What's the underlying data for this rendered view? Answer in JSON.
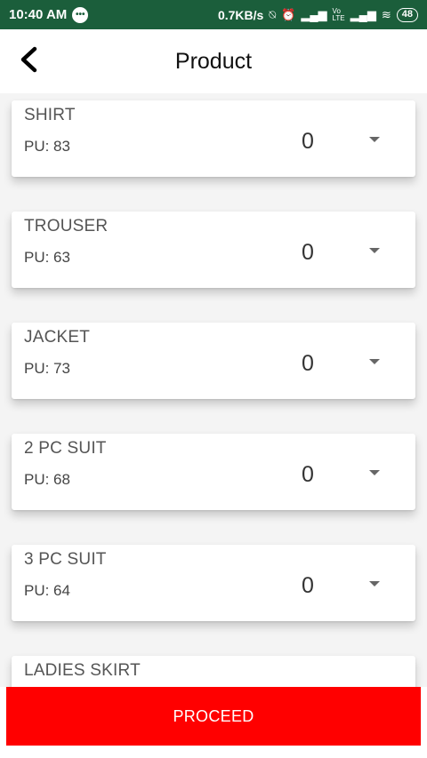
{
  "status_bar": {
    "time": "10:40 AM",
    "speed": "0.7KB/s",
    "battery": "48",
    "icons": [
      "message-icon",
      "no-notification-icon",
      "alarm-icon",
      "signal-icon",
      "volte-icon",
      "signal-icon",
      "wifi-icon",
      "battery-icon"
    ],
    "background": "#1b5e3b"
  },
  "header": {
    "title": "Product",
    "back_icon": "chevron-left-icon"
  },
  "products": [
    {
      "name": "SHIRT",
      "pu": "PU: 83",
      "qty": "0"
    },
    {
      "name": "TROUSER",
      "pu": "PU: 63",
      "qty": "0"
    },
    {
      "name": "JACKET",
      "pu": "PU: 73",
      "qty": "0"
    },
    {
      "name": "2 PC SUIT",
      "pu": "PU: 68",
      "qty": "0"
    },
    {
      "name": "3 PC SUIT",
      "pu": "PU: 64",
      "qty": "0"
    },
    {
      "name": "LADIES SKIRT"
    }
  ],
  "footer": {
    "proceed_label": "PROCEED",
    "proceed_color": "#ff0000"
  }
}
